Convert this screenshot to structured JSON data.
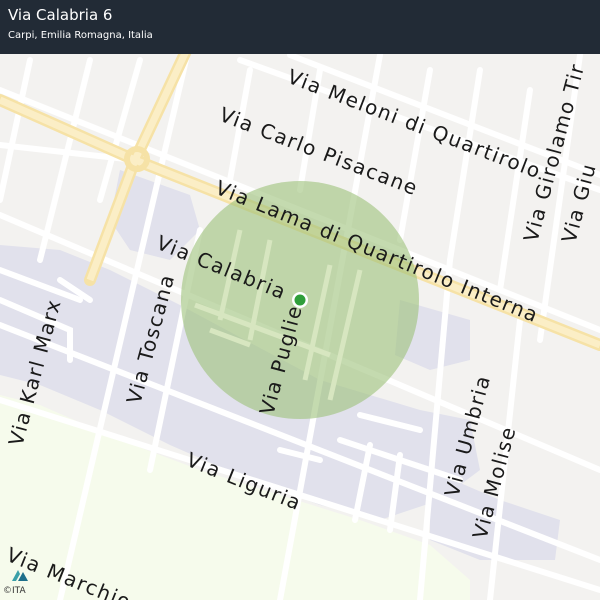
{
  "header": {
    "title": "Via Calabria 6",
    "subtitle": "Carpi, Emilia Romagna, Italia"
  },
  "streets": {
    "meloni": "Via Meloni di Quartirolo",
    "pisacane": "Via Carlo Pisacane",
    "lama": "Via Lama di Quartirolo Interna",
    "calabria": "Via Calabria",
    "toscana": "Via Toscana",
    "karl_marx": "Via Karl Marx",
    "puglie": "Via Puglie",
    "liguria": "Via Liguria",
    "umbria": "Via Umbria",
    "molise": "Via Molise",
    "girolamo": "Via Girolamo Tir",
    "giu": "Via Giu",
    "marchio": "Via Marchion"
  },
  "map": {
    "marker_color": "#2f9e3a",
    "accuracy_circle_color": "#9cc27a",
    "main_road_color": "#f7e7b0",
    "block_color": "#e1e1ec",
    "park_color": "#f6fbec"
  },
  "attribution": "©ITA"
}
